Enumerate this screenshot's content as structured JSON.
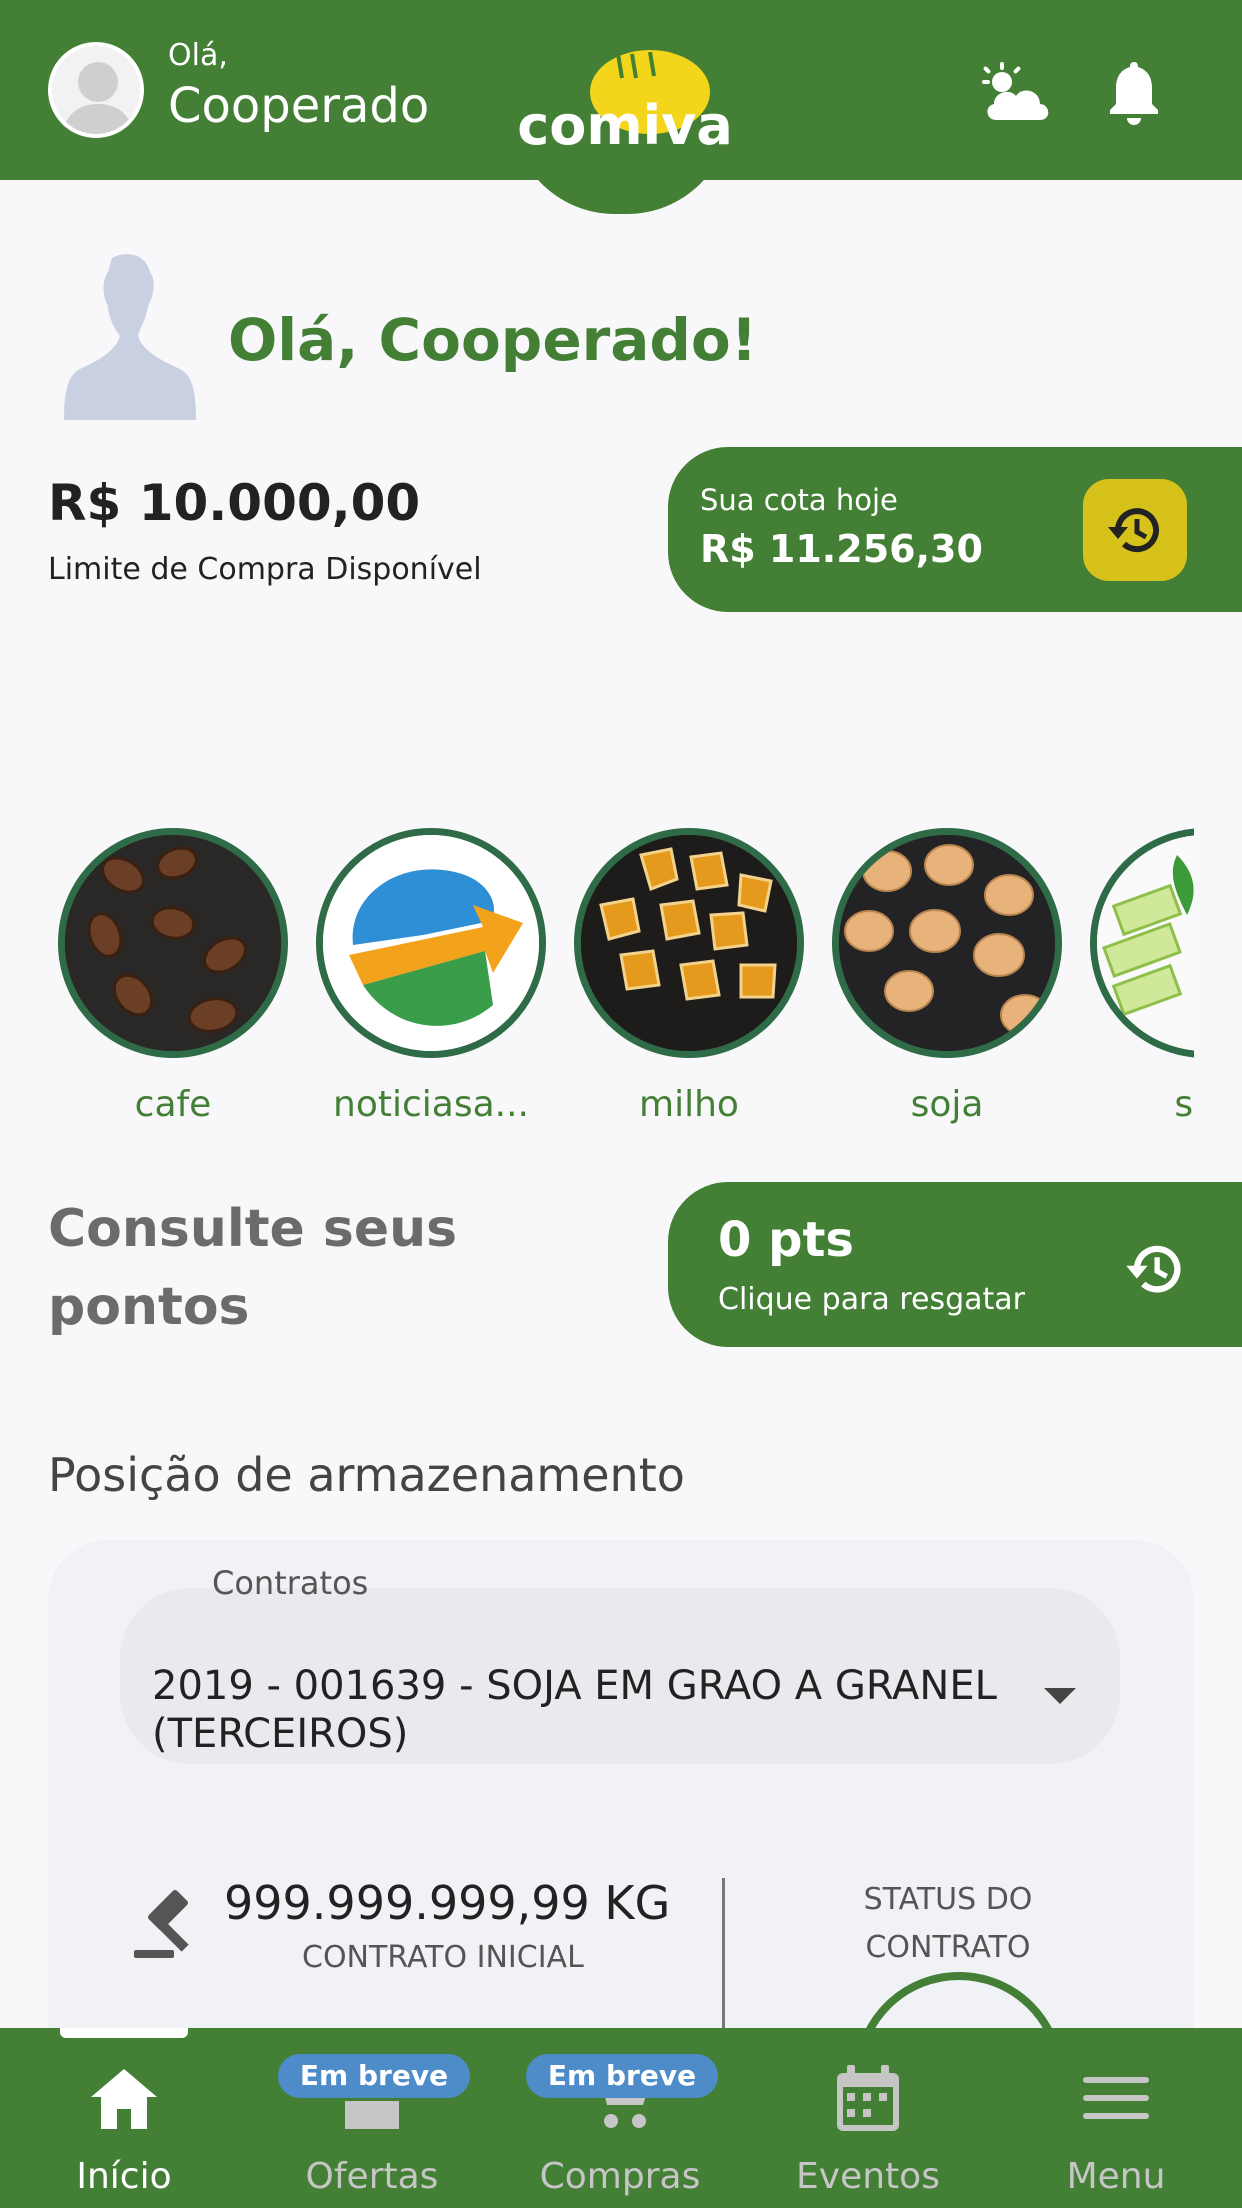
{
  "header": {
    "greeting_small": "Olá,",
    "greeting_name": "Cooperado",
    "logo_text": "comiva",
    "icons": [
      "avatar-icon",
      "weather-icon",
      "bell-icon"
    ],
    "brand_color": "#437f35"
  },
  "hello": {
    "title": "Olá, Cooperado!"
  },
  "limit": {
    "value": "R$ 10.000,00",
    "label": "Limite de Compra Disponível"
  },
  "quota": {
    "label": "Sua cota hoje",
    "value": "R$ 11.256,30",
    "button_icon": "history-icon",
    "button_color": "#d6c21a"
  },
  "categories": [
    {
      "label": "cafe",
      "image": "coffee-beans"
    },
    {
      "label": "noticiasa...",
      "image": "news-logo"
    },
    {
      "label": "milho",
      "image": "corn-kernels"
    },
    {
      "label": "soja",
      "image": "soybeans"
    },
    {
      "label": "suc",
      "image": "sugarcane"
    }
  ],
  "points": {
    "title": "Consulte seus pontos",
    "value": "0 pts",
    "action": "Clique para resgatar",
    "icon": "history-icon"
  },
  "storage": {
    "title": "Posição de armazenamento",
    "contracts_label": "Contratos",
    "contract_selected": "2019 - 001639 - SOJA EM GRAO A GRANEL (TERCEIROS)",
    "initial_qty": "999.999.999,99 KG",
    "initial_label": "CONTRATO INICIAL",
    "status_label": "STATUS DO CONTRATO"
  },
  "nav": {
    "items": [
      {
        "label": "Início",
        "icon": "home-icon",
        "active": true
      },
      {
        "label": "Ofertas",
        "icon": "store-icon",
        "badge": "Em breve"
      },
      {
        "label": "Compras",
        "icon": "cart-icon",
        "badge": "Em breve"
      },
      {
        "label": "Eventos",
        "icon": "calendar-icon"
      },
      {
        "label": "Menu",
        "icon": "menu-icon"
      }
    ]
  }
}
